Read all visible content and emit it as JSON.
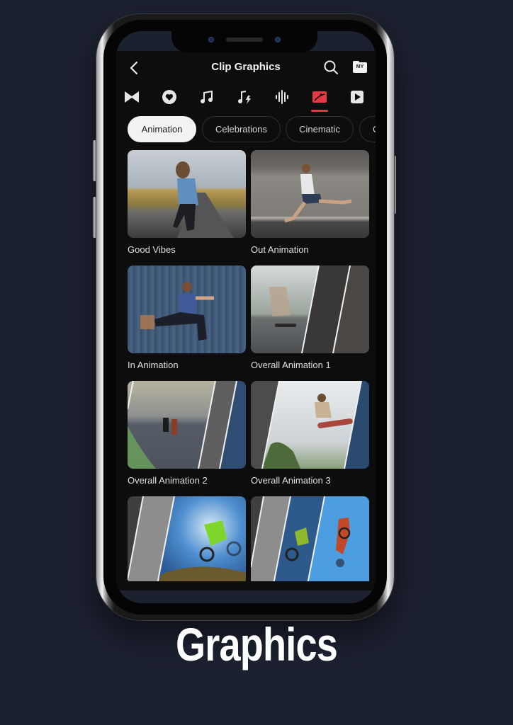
{
  "app": {
    "title": "Clip Graphics",
    "header_icons": {
      "back": "chevron-left-icon",
      "search": "search-icon",
      "my_folder": "my-folder-icon",
      "my_folder_label": "MY"
    }
  },
  "category_icons": [
    {
      "name": "transition-icon",
      "active": false
    },
    {
      "name": "favorite-heart-icon",
      "active": false
    },
    {
      "name": "music-icon",
      "active": false
    },
    {
      "name": "sound-effect-icon",
      "active": false
    },
    {
      "name": "voice-waveform-icon",
      "active": false
    },
    {
      "name": "graphics-sticker-icon",
      "active": true
    },
    {
      "name": "video-play-icon",
      "active": false
    }
  ],
  "colors": {
    "accent": "#e53945",
    "background": "#1c2130",
    "app_background": "#0d0d0d",
    "chip_active_bg": "#f2f2f2"
  },
  "chips": [
    {
      "label": "Animation",
      "active": true
    },
    {
      "label": "Celebrations",
      "active": false
    },
    {
      "label": "Cinematic",
      "active": false
    },
    {
      "label": "C",
      "active": false
    }
  ],
  "items": [
    {
      "label": "Good Vibes",
      "scene": "person dancing on country road"
    },
    {
      "label": "Out Animation",
      "scene": "man sprinting past brick wall"
    },
    {
      "label": "In Animation",
      "scene": "boy leaping in front of blue wall"
    },
    {
      "label": "Overall Animation 1",
      "scene": "skateboarder with sliced panels"
    },
    {
      "label": "Overall Animation 2",
      "scene": "motorcyclists on winding road with sliced panels"
    },
    {
      "label": "Overall Animation 3",
      "scene": "skateboarder mid-air with sliced panels"
    },
    {
      "label": "",
      "scene": "motocross rider jumping, sliced panels"
    },
    {
      "label": "",
      "scene": "motocross rider flipping, sliced panels"
    }
  ],
  "caption": "Graphics"
}
